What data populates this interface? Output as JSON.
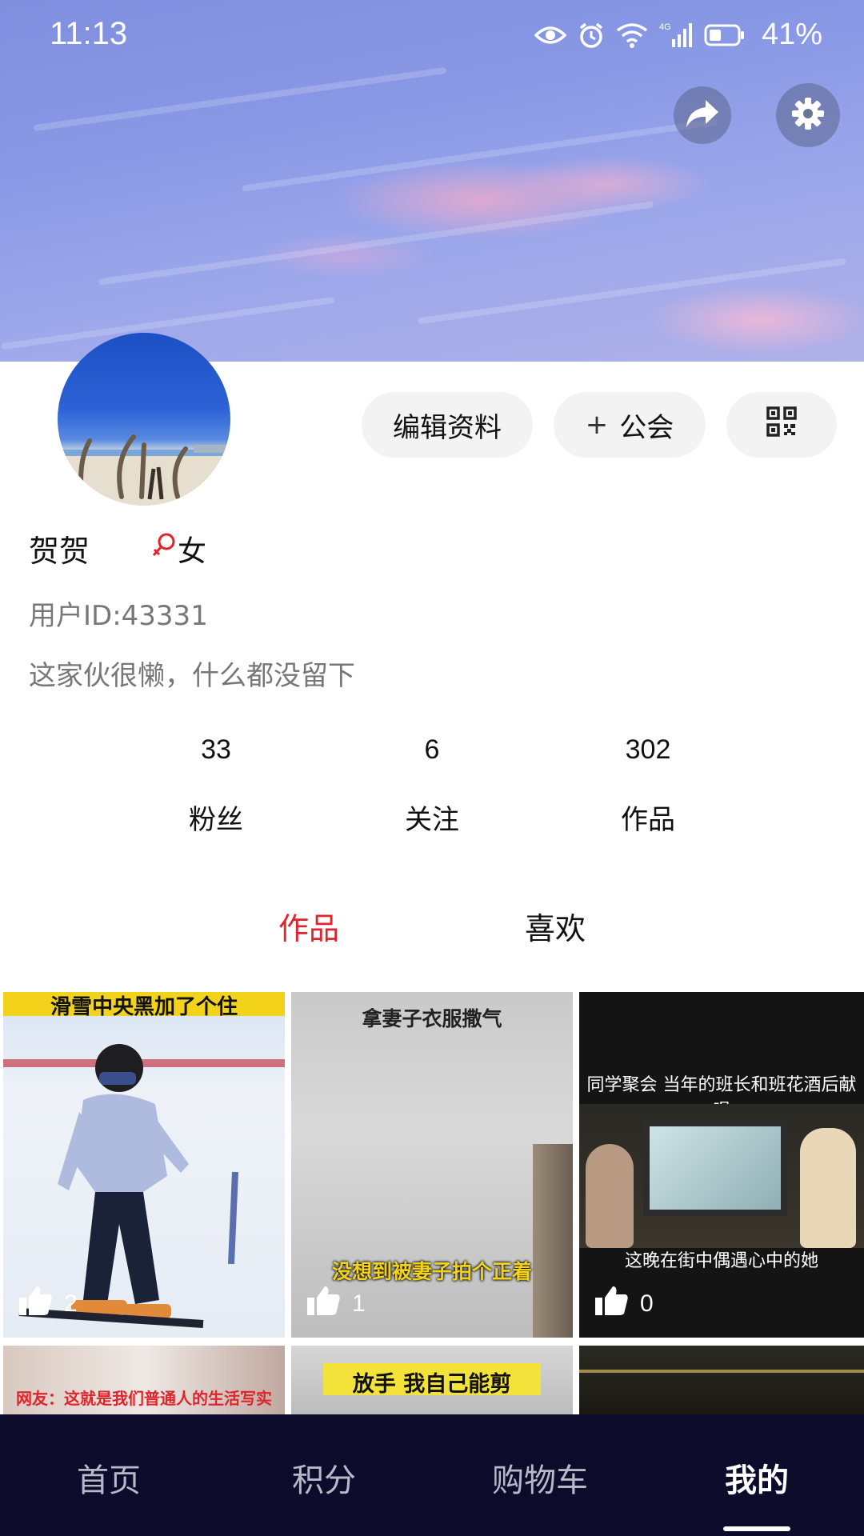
{
  "status_bar": {
    "time": "11:13",
    "network": "4G",
    "battery": "41%"
  },
  "header": {
    "share_icon": "share-arrow-icon",
    "settings_icon": "gear-icon"
  },
  "profile": {
    "username": "贺贺",
    "gender": "女",
    "user_id": "用户ID:43331",
    "bio": "这家伙很懒，什么都没留下",
    "gender_color": "#e0242b"
  },
  "actions": {
    "edit_label": "编辑资料",
    "guild_label": "公会",
    "guild_prefix": "+",
    "qr_icon": "qr-code-icon"
  },
  "stats": {
    "fans_count": "33",
    "fans_label": "粉丝",
    "following_count": "6",
    "following_label": "关注",
    "works_count": "302",
    "works_label": "作品"
  },
  "content_tabs": {
    "works": "作品",
    "likes": "喜欢",
    "active_color": "#e0242b"
  },
  "videos": [
    {
      "caption_top": "滑雪中央黑加了个住",
      "likes": "2"
    },
    {
      "caption_top": "拿妻子衣服撒气",
      "caption_bottom": "没想到被妻子拍个正着",
      "likes": "1"
    },
    {
      "caption_top": "同学聚会 当年的班长和班花酒后献唱",
      "caption_bottom": "这晚在街中偶遇心中的她",
      "likes": "0"
    },
    {
      "caption_top": "网友：这就是我们普通人的生活写实"
    },
    {
      "caption_top": "放手 我自己能剪"
    },
    {
      "caption_top": ""
    }
  ],
  "bottom_nav": {
    "home": "首页",
    "points": "积分",
    "cart": "购物车",
    "mine": "我的"
  }
}
